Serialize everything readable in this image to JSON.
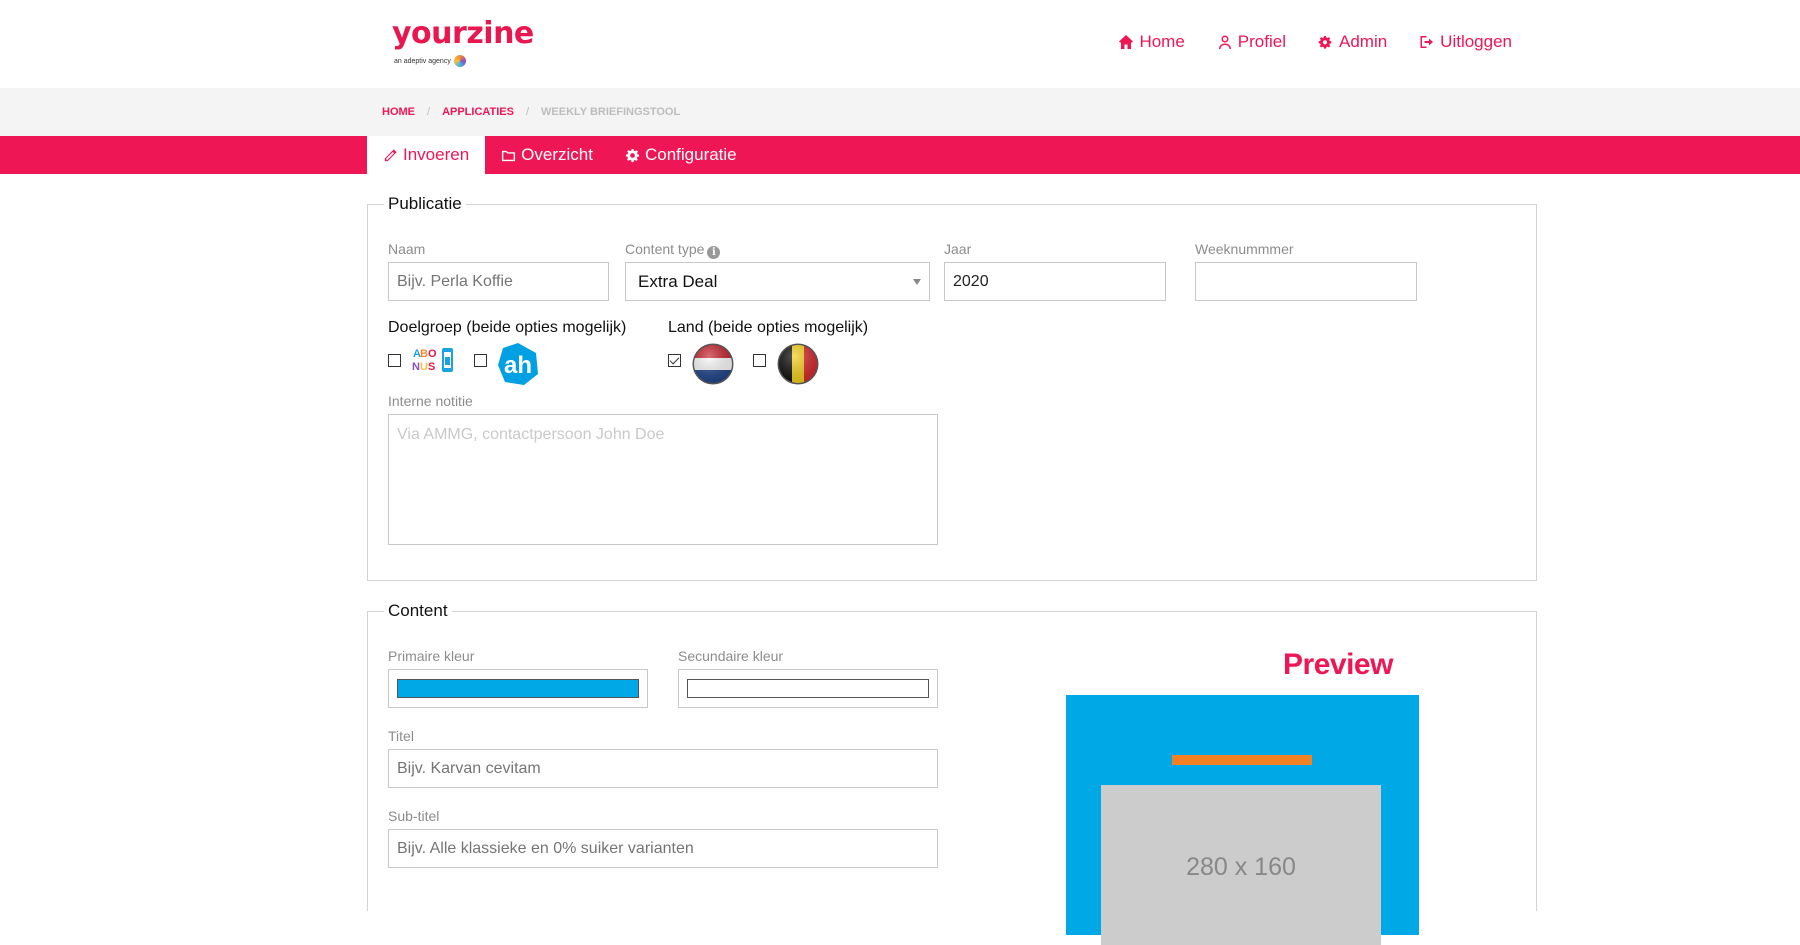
{
  "brand": {
    "logo_text": "yourzine",
    "logo_sub": "an adeptiv agency",
    "accent_color": "#ef1655"
  },
  "topnav": [
    {
      "label": "Home",
      "icon": "home-icon"
    },
    {
      "label": "Profiel",
      "icon": "user-icon"
    },
    {
      "label": "Admin",
      "icon": "gears-icon"
    },
    {
      "label": "Uitloggen",
      "icon": "sign-out-icon"
    }
  ],
  "breadcrumb": {
    "items": [
      "HOME",
      "APPLICATIES"
    ],
    "separator": "/",
    "current": "WEEKLY BRIEFINGSTOOL"
  },
  "tabs": [
    {
      "label": "Invoeren",
      "icon": "pencil-icon",
      "active": true
    },
    {
      "label": "Overzicht",
      "icon": "folder-icon",
      "active": false
    },
    {
      "label": "Configuratie",
      "icon": "gear-icon",
      "active": false
    }
  ],
  "publicatie": {
    "legend": "Publicatie",
    "naam": {
      "label": "Naam",
      "placeholder": "Bijv. Perla Koffie",
      "value": ""
    },
    "content_type": {
      "label": "Content type",
      "value": "Extra Deal"
    },
    "jaar": {
      "label": "Jaar",
      "value": "2020"
    },
    "weeknummer": {
      "label": "Weeknummmer",
      "value": ""
    },
    "doelgroep": {
      "label": "Doelgroep (beide opties mogelijk)",
      "options": [
        {
          "name": "abonus-logo",
          "text": "ABO NUS",
          "checked": false
        },
        {
          "name": "ah-logo",
          "text": "ah",
          "checked": false
        }
      ]
    },
    "land": {
      "label": "Land (beide opties mogelijk)",
      "options": [
        {
          "name": "netherlands-flag",
          "checked": true
        },
        {
          "name": "belgium-flag",
          "checked": false
        }
      ]
    },
    "notitie": {
      "label": "Interne notitie",
      "placeholder": "Via AMMG, contactpersoon John Doe"
    }
  },
  "content": {
    "legend": "Content",
    "primaire_kleur": {
      "label": "Primaire kleur",
      "value": "#00a9e6"
    },
    "secundaire_kleur": {
      "label": "Secundaire kleur",
      "value": "#ffffff"
    },
    "titel": {
      "label": "Titel",
      "placeholder": "Bijv. Karvan cevitam"
    },
    "subtitel": {
      "label": "Sub-titel",
      "placeholder": "Bijv. Alle klassieke en 0% suiker varianten"
    }
  },
  "preview": {
    "title": "Preview",
    "bg_color": "#00a9e6",
    "bar_color": "#f28123",
    "image_label": "280 x 160"
  }
}
